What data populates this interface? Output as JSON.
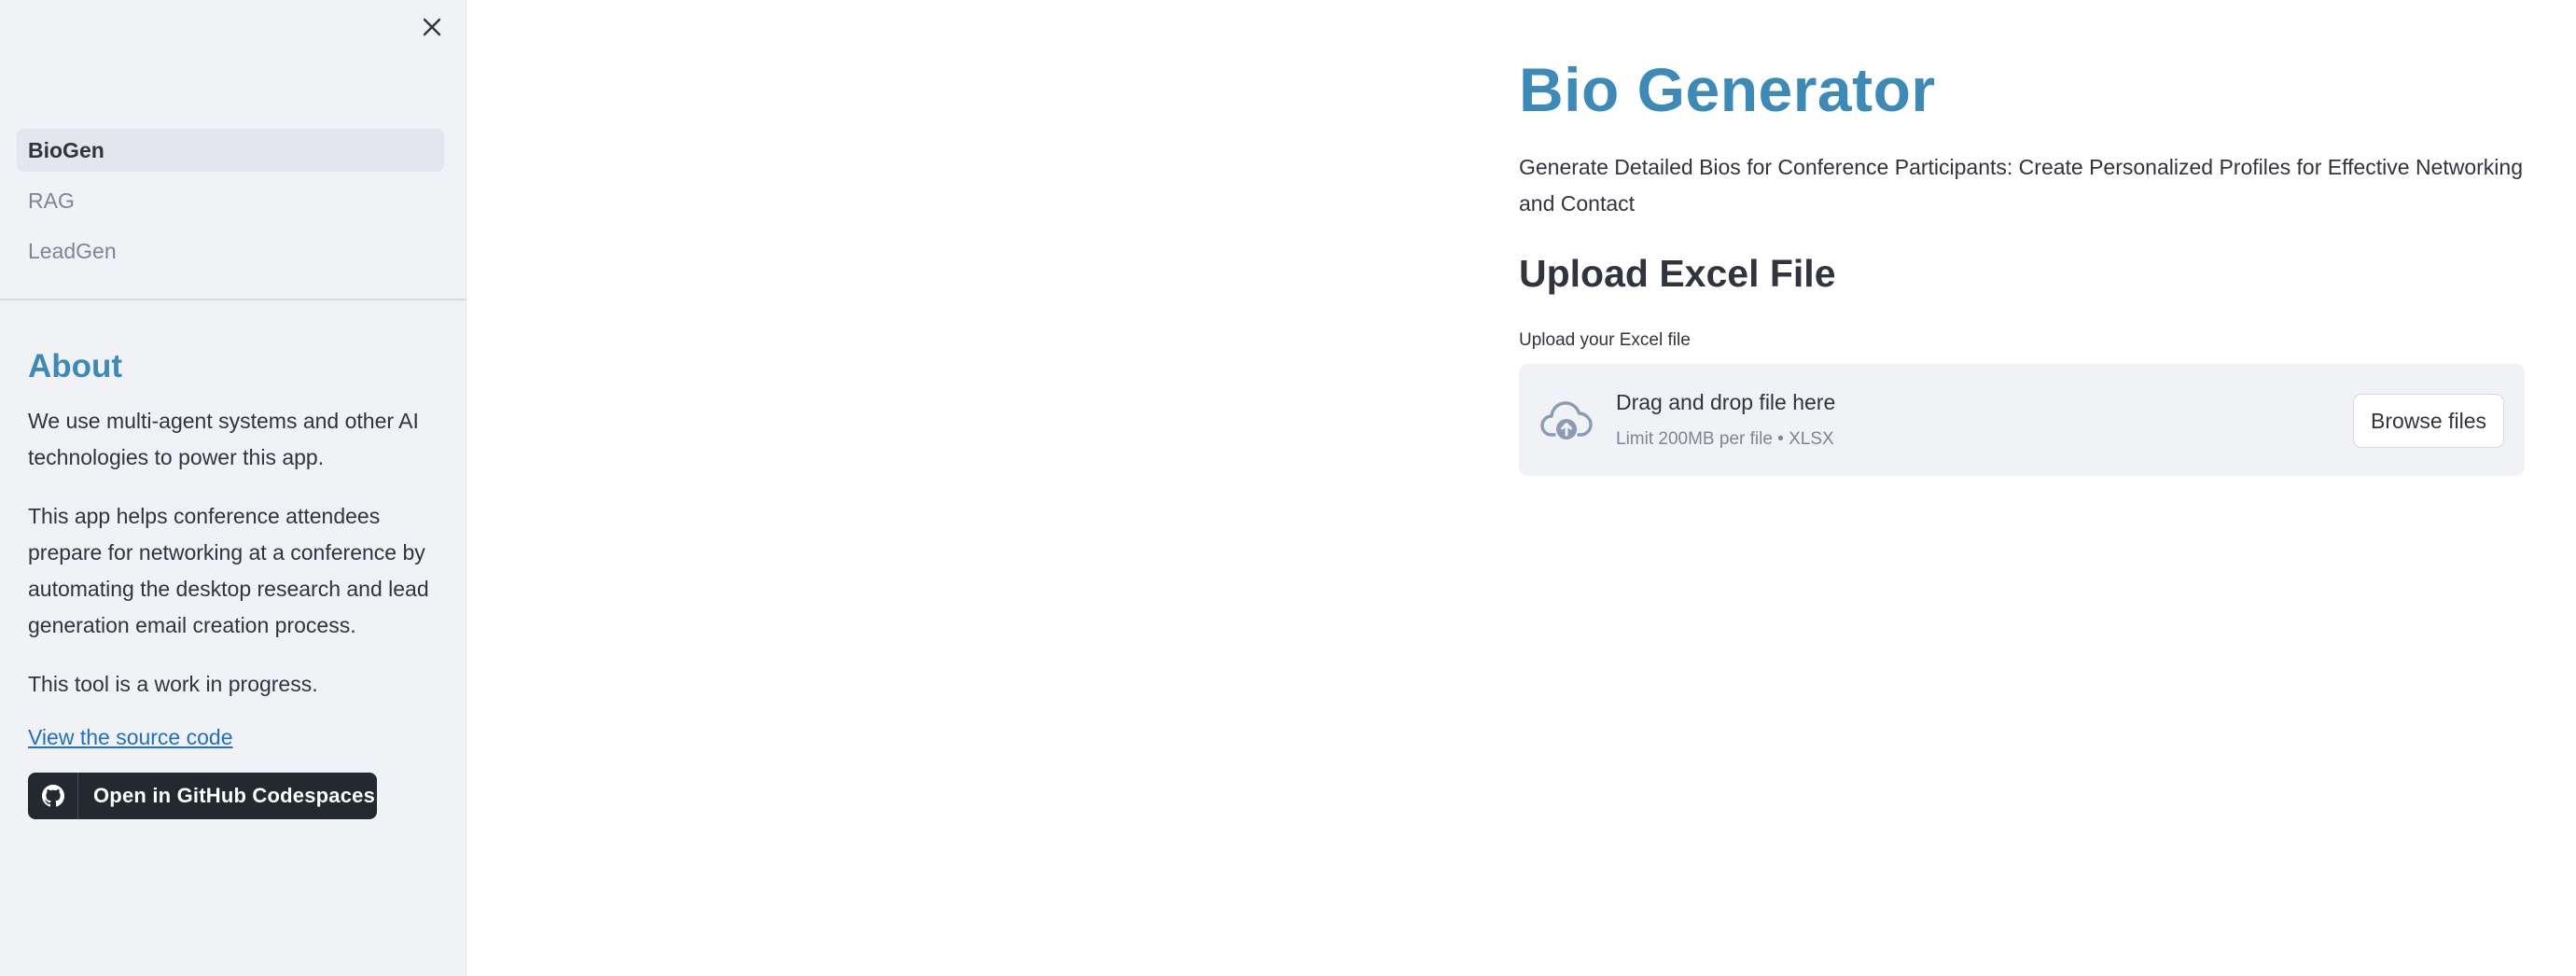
{
  "sidebar": {
    "close_icon": "close-icon",
    "nav": [
      {
        "label": "BioGen",
        "active": true
      },
      {
        "label": "RAG",
        "active": false
      },
      {
        "label": "LeadGen",
        "active": false
      }
    ],
    "about": {
      "title": "About",
      "paragraphs": [
        "We use multi-agent systems and other AI technologies to power this app.",
        "This app helps conference attendees prepare for networking at a conference by automating the desktop research and lead generation email creation process.",
        "This tool is a work in progress."
      ],
      "source_link": "View the source code",
      "codespaces_button": "Open in GitHub Codespaces",
      "codespaces_icon": "github-icon"
    }
  },
  "main": {
    "title": "Bio Generator",
    "subtitle": "Generate Detailed Bios for Conference Participants: Create Personalized Profiles for Effective Networking and Contact",
    "section_title": "Upload Excel File",
    "uploader": {
      "label": "Upload your Excel file",
      "icon": "cloud-upload-icon",
      "drop_text": "Drag and drop file here",
      "limit_text": "Limit 200MB per file • XLSX",
      "browse_button": "Browse files"
    }
  },
  "colors": {
    "accent": "#3b8ab8",
    "sidebar_bg": "#f0f2f6",
    "text": "#31333f",
    "muted_text": "#808495",
    "link": "#1f6fc4",
    "codespaces_bg": "#24292f"
  }
}
